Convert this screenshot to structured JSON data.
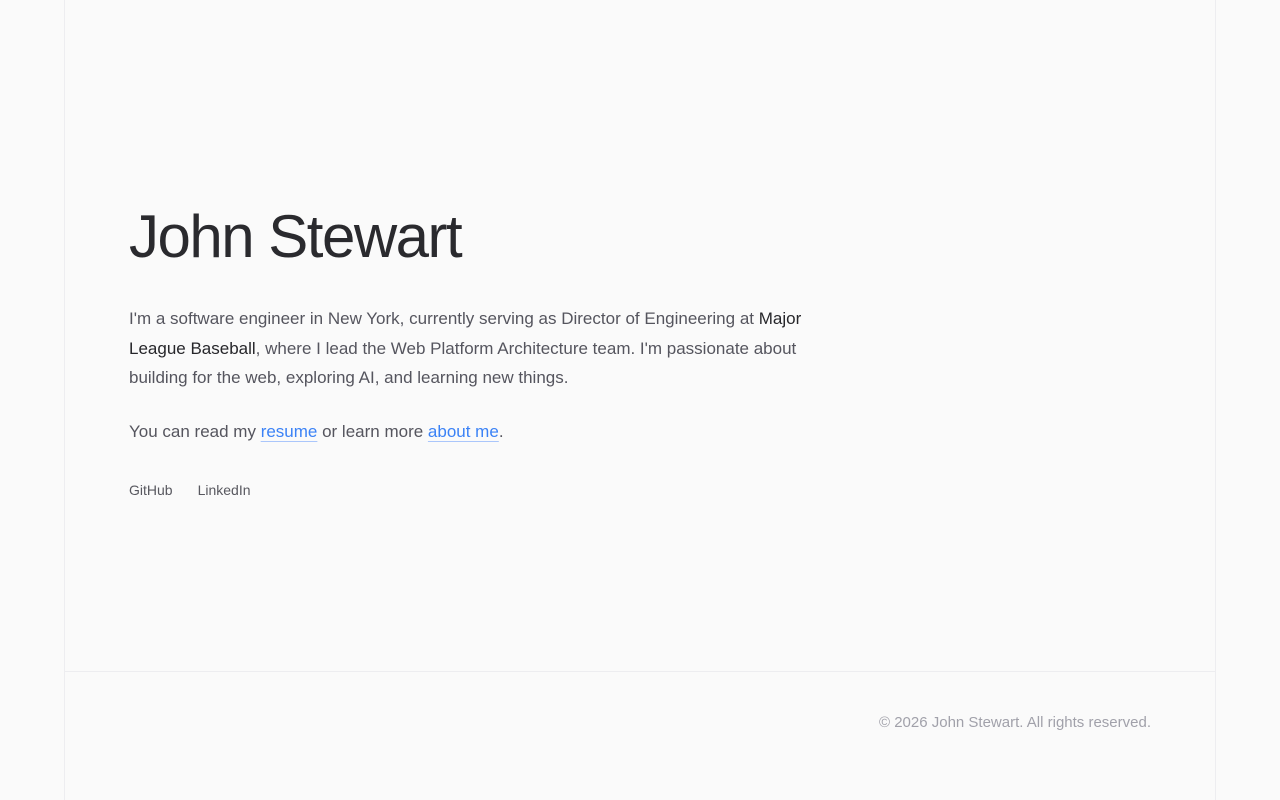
{
  "colors": {
    "background": "#fafafa",
    "border": "#ededf0",
    "heading_text": "#2a2a2e",
    "body_text": "#55555e",
    "emphasis_text": "#26262a",
    "link_accent": "#3b82f6",
    "link_underline": "#aac6fb",
    "footer_text": "#a1a1aa"
  },
  "hero": {
    "heading": "John Stewart",
    "intro": {
      "before_org": "I'm a software engineer in New York, currently serving as Director of Engineering at ",
      "org": "Major League Baseball",
      "after_org": ", where I lead the Web Platform Architecture team. I'm passionate about building for the web, exploring AI, and learning new things."
    },
    "links_sentence": {
      "part1": "You can read my ",
      "resume_link_label": "resume",
      "part2": " or learn more ",
      "about_link_label": "about me",
      "part3": "."
    },
    "social": [
      {
        "label": "GitHub"
      },
      {
        "label": "LinkedIn"
      }
    ]
  },
  "footer": {
    "copyright": "© 2026 John Stewart. All rights reserved."
  }
}
